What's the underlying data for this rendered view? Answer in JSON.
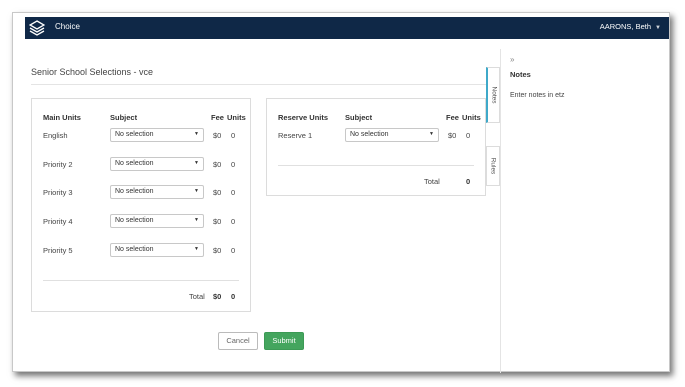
{
  "navbar": {
    "app_title": "Choice",
    "user_name": "AARONS, Beth",
    "user_caret": "▼"
  },
  "page": {
    "title": "Senior School Selections - vce"
  },
  "main_units": {
    "headers": {
      "label": "Main Units",
      "subject": "Subject",
      "fee": "Fee",
      "units": "Units"
    },
    "rows": [
      {
        "label": "English",
        "subject": "No selection",
        "fee": "$0",
        "units": "0"
      },
      {
        "label": "Priority 2",
        "subject": "No selection",
        "fee": "$0",
        "units": "0"
      },
      {
        "label": "Priority 3",
        "subject": "No selection",
        "fee": "$0",
        "units": "0"
      },
      {
        "label": "Priority 4",
        "subject": "No selection",
        "fee": "$0",
        "units": "0"
      },
      {
        "label": "Priority 5",
        "subject": "No selection",
        "fee": "$0",
        "units": "0"
      }
    ],
    "total": {
      "label": "Total",
      "fee": "$0",
      "units": "0"
    }
  },
  "reserve_units": {
    "headers": {
      "label": "Reserve Units",
      "subject": "Subject",
      "fee": "Fee",
      "units": "Units"
    },
    "rows": [
      {
        "label": "Reserve 1",
        "subject": "No selection",
        "fee": "$0",
        "units": "0"
      }
    ],
    "total": {
      "label": "Total",
      "units": "0"
    }
  },
  "buttons": {
    "cancel": "Cancel",
    "submit": "Submit"
  },
  "sidebar": {
    "tabs": {
      "notes": "Notes",
      "rules": "Rules"
    },
    "collapse_glyph": "»",
    "notes_header": "Notes",
    "notes_text": "Enter notes in etz"
  },
  "colors": {
    "navbar": "#0f2847",
    "submit": "#44a55e",
    "active_tab_accent": "#3fa9c9"
  },
  "icons": {
    "logo": "stacked-layers-icon",
    "dropdown": "caret-down-icon",
    "collapse": "double-chevron-right-icon"
  }
}
